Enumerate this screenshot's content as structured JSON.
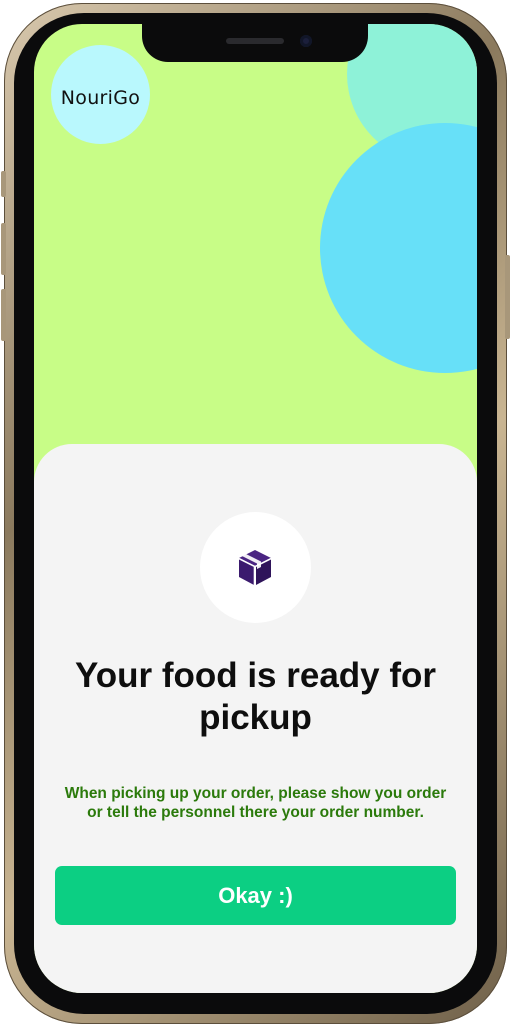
{
  "app": {
    "logo_text": "NouriGo"
  },
  "dialog": {
    "icon": "package-icon",
    "title": "Your food is ready for pickup",
    "message": "When picking up your order, please show you order or tell the personnel there your order number.",
    "okay_label": "Okay :)"
  },
  "colors": {
    "background": "#c8fd87",
    "sheet": "#f4f4f4",
    "accent_button": "#0ccf83",
    "message_text": "#2b7a0b",
    "icon": "#3b1a6e",
    "logo_circle": "#b9f8fd",
    "blob_mint": "#8ef2d8",
    "blob_blue": "#67e0f8"
  }
}
